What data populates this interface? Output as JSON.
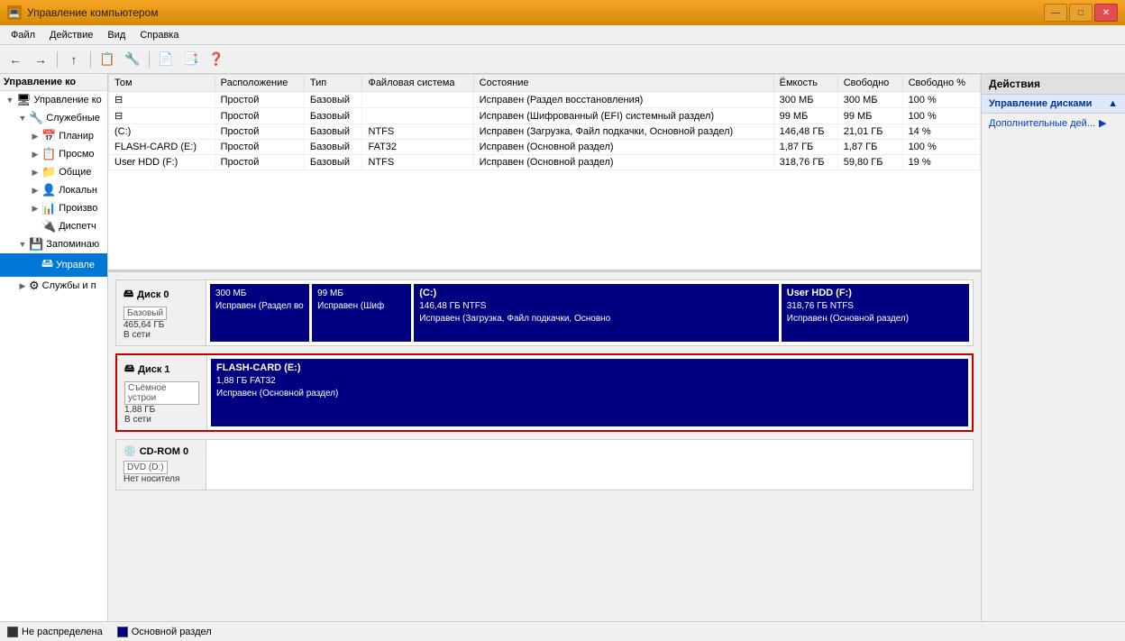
{
  "window": {
    "title": "Управление компьютером",
    "icon": "💻"
  },
  "title_btn": {
    "minimize": "—",
    "maximize": "□",
    "close": "✕"
  },
  "menu": {
    "items": [
      "Файл",
      "Действие",
      "Вид",
      "Справка"
    ]
  },
  "toolbar": {
    "buttons": [
      "←",
      "→",
      "⬆",
      "📋",
      "📋",
      "🔧",
      "📄",
      "📑",
      "📑"
    ]
  },
  "left_panel": {
    "header": "Управление ко",
    "tree": [
      {
        "label": "Служебные",
        "level": 1,
        "expanded": true,
        "icon": "🖥"
      },
      {
        "label": "Планир",
        "level": 2,
        "icon": "📅"
      },
      {
        "label": "Просмо",
        "level": 2,
        "icon": "📋"
      },
      {
        "label": "Общие",
        "level": 2,
        "icon": "🔧"
      },
      {
        "label": "Локальн",
        "level": 2,
        "icon": "💻"
      },
      {
        "label": "Произво",
        "level": 2,
        "icon": "📊"
      },
      {
        "label": "Диспетч",
        "level": 2,
        "icon": "🔌"
      },
      {
        "label": "Запоминаю",
        "level": 1,
        "expanded": true,
        "icon": "💾"
      },
      {
        "label": "Управле",
        "level": 2,
        "icon": "🖴",
        "selected": true
      },
      {
        "label": "Службы и п",
        "level": 1,
        "icon": "⚙"
      }
    ]
  },
  "table": {
    "columns": [
      "Том",
      "Расположение",
      "Тип",
      "Файловая система",
      "Состояние",
      "Ёмкость",
      "Свободно",
      "Свободно %"
    ],
    "rows": [
      {
        "volume": "",
        "location": "Простой",
        "type": "Базовый",
        "fs": "",
        "status": "Исправен (Раздел восстановления)",
        "capacity": "300 МБ",
        "free": "300 МБ",
        "free_pct": "100 %"
      },
      {
        "volume": "",
        "location": "Простой",
        "type": "Базовый",
        "fs": "",
        "status": "Исправен (Шифрованный (EFI) системный раздел)",
        "capacity": "99 МБ",
        "free": "99 МБ",
        "free_pct": "100 %"
      },
      {
        "volume": "(C:)",
        "location": "Простой",
        "type": "Базовый",
        "fs": "NTFS",
        "status": "Исправен (Загрузка, Файл подкачки, Основной раздел)",
        "capacity": "146,48 ГБ",
        "free": "21,01 ГБ",
        "free_pct": "14 %"
      },
      {
        "volume": "FLASH-CARD (E:)",
        "location": "Простой",
        "type": "Базовый",
        "fs": "FAT32",
        "status": "Исправен (Основной раздел)",
        "capacity": "1,87 ГБ",
        "free": "1,87 ГБ",
        "free_pct": "100 %"
      },
      {
        "volume": "User HDD (F:)",
        "location": "Простой",
        "type": "Базовый",
        "fs": "NTFS",
        "status": "Исправен (Основной раздел)",
        "capacity": "318,76 ГБ",
        "free": "59,80 ГБ",
        "free_pct": "19 %"
      }
    ]
  },
  "disks": [
    {
      "id": "disk0",
      "label": "Диск 0",
      "type": "Базовый",
      "size": "465,64 ГБ",
      "status": "В сети",
      "highlighted": false,
      "partitions": [
        {
          "flex": 1,
          "title": "",
          "size": "300 МБ",
          "status": "Исправен (Раздел во",
          "color": "primary"
        },
        {
          "flex": 1,
          "title": "",
          "size": "99 МБ",
          "status": "Исправен (Шиф",
          "color": "primary"
        },
        {
          "flex": 4,
          "title": "(C:)",
          "size": "146,48 ГБ NTFS",
          "status": "Исправен (Загрузка, Файл подкачки, Основно",
          "color": "primary"
        },
        {
          "flex": 2,
          "title": "User HDD  (F:)",
          "size": "318,76 ГБ NTFS",
          "status": "Исправен (Основной раздел)",
          "color": "primary"
        }
      ]
    },
    {
      "id": "disk1",
      "label": "Диск 1",
      "type": "Съёмное устрои",
      "size": "1,88 ГБ",
      "status": "В сети",
      "highlighted": true,
      "partitions": [
        {
          "flex": 1,
          "title": "FLASH-CARD  (E:)",
          "size": "1,88 ГБ FAT32",
          "status": "Исправен (Основной раздел)",
          "color": "primary"
        }
      ]
    },
    {
      "id": "cdrom0",
      "label": "CD-ROM 0",
      "type": "DVD (D:)",
      "size": "",
      "status": "Нет носителя",
      "highlighted": false,
      "partitions": []
    }
  ],
  "legend": {
    "items": [
      {
        "color": "unallocated",
        "label": "Не распределена"
      },
      {
        "color": "primary",
        "label": "Основной раздел"
      }
    ]
  },
  "actions_panel": {
    "header": "Действия",
    "sections": [
      {
        "title": "Управление дисками",
        "icon": "▲",
        "links": [
          {
            "label": "Дополнительные дей...",
            "arrow": "→"
          }
        ]
      }
    ]
  }
}
